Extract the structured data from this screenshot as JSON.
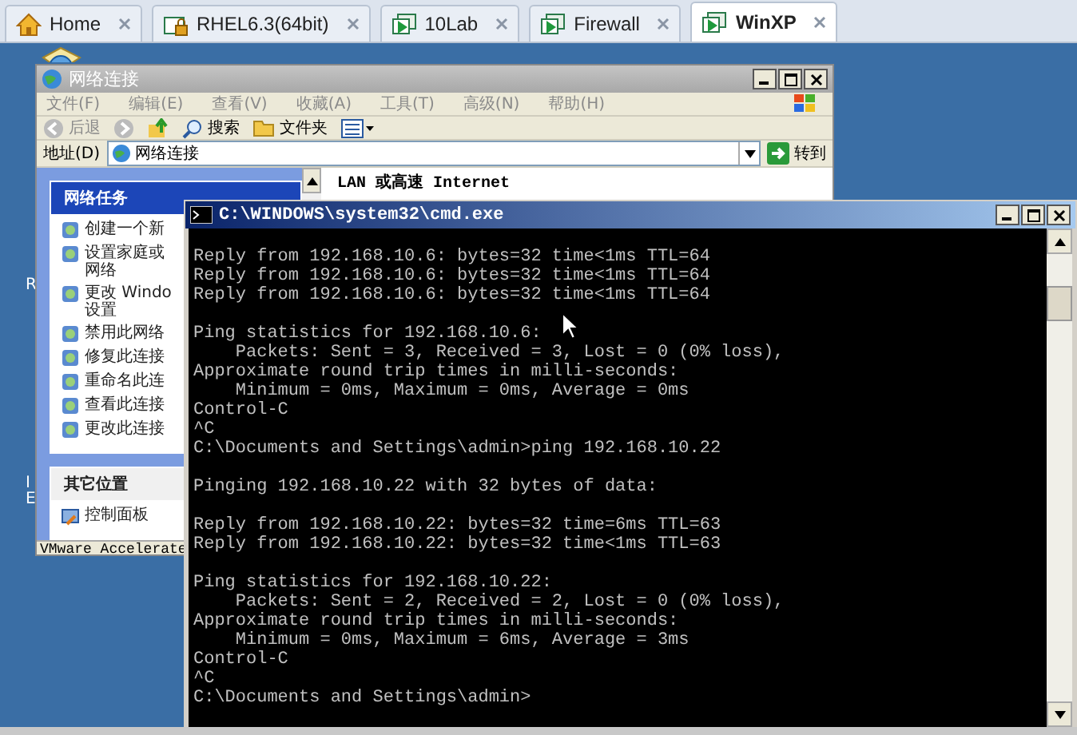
{
  "tabs": [
    {
      "label": "Home",
      "kind": "home",
      "selected": false
    },
    {
      "label": "RHEL6.3(64bit)",
      "kind": "locked",
      "selected": false
    },
    {
      "label": "10Lab",
      "kind": "vm",
      "selected": false
    },
    {
      "label": "Firewall",
      "kind": "vm",
      "selected": false
    },
    {
      "label": "WinXP",
      "kind": "vm",
      "selected": true
    }
  ],
  "desktop_labels": [
    "R",
    "I",
    "E"
  ],
  "explorer": {
    "title": "网络连接",
    "menu": [
      "文件(F)",
      "编辑(E)",
      "查看(V)",
      "收藏(A)",
      "工具(T)",
      "高级(N)",
      "帮助(H)"
    ],
    "toolbar": {
      "back": "后退",
      "search": "搜索",
      "folders": "文件夹"
    },
    "address": {
      "label": "地址(D)",
      "value": "网络连接",
      "go": "转到"
    },
    "tasks": {
      "title": "网络任务",
      "items": [
        "创建一个新",
        "设置家庭或网络",
        "更改 Windo\n设置",
        "禁用此网络",
        "修复此连接",
        "重命名此连",
        "查看此连接",
        "更改此连接"
      ]
    },
    "other_places": {
      "title": "其它位置",
      "items": [
        "控制面板"
      ]
    },
    "group_heading": "LAN 或高速 Internet",
    "status": "VMware Accelerate"
  },
  "cmd": {
    "title": "C:\\WINDOWS\\system32\\cmd.exe",
    "blocks": [
      [
        "Reply from 192.168.10.6: bytes=32 time<1ms TTL=64",
        "Reply from 192.168.10.6: bytes=32 time<1ms TTL=64",
        "Reply from 192.168.10.6: bytes=32 time<1ms TTL=64"
      ],
      [
        "Ping statistics for 192.168.10.6:",
        "    Packets: Sent = 3, Received = 3, Lost = 0 (0% loss),",
        "Approximate round trip times in milli-seconds:",
        "    Minimum = 0ms, Maximum = 0ms, Average = 0ms",
        "Control-C",
        "^C",
        "C:\\Documents and Settings\\admin>ping 192.168.10.22"
      ],
      [
        "Pinging 192.168.10.22 with 32 bytes of data:"
      ],
      [
        "Reply from 192.168.10.22: bytes=32 time=6ms TTL=63",
        "Reply from 192.168.10.22: bytes=32 time<1ms TTL=63"
      ],
      [
        "Ping statistics for 192.168.10.22:",
        "    Packets: Sent = 2, Received = 2, Lost = 0 (0% loss),",
        "Approximate round trip times in milli-seconds:",
        "    Minimum = 0ms, Maximum = 6ms, Average = 3ms",
        "Control-C",
        "^C",
        "C:\\Documents and Settings\\admin>"
      ]
    ]
  }
}
